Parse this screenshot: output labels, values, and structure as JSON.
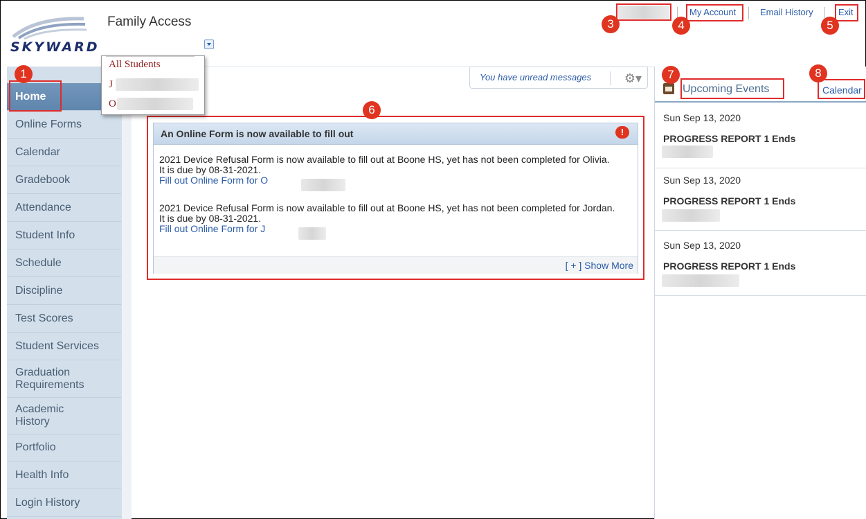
{
  "header": {
    "logo_text": "SKYWARD",
    "app_title": "Family Access"
  },
  "student_dropdown": {
    "items": [
      "All Students",
      "J",
      "O"
    ]
  },
  "topnav": {
    "my_account": "My Account",
    "email_history": "Email History",
    "exit": "Exit"
  },
  "sidebar": {
    "items": [
      {
        "label": "Home",
        "active": true
      },
      {
        "label": "Online Forms"
      },
      {
        "label": "Calendar"
      },
      {
        "label": "Gradebook"
      },
      {
        "label": "Attendance"
      },
      {
        "label": "Student Info"
      },
      {
        "label": "Schedule"
      },
      {
        "label": "Discipline"
      },
      {
        "label": "Test Scores"
      },
      {
        "label": "Student Services"
      },
      {
        "label": "Graduation Requirements"
      },
      {
        "label": "Academic History"
      },
      {
        "label": "Portfolio"
      },
      {
        "label": "Health Info"
      },
      {
        "label": "Login History"
      }
    ]
  },
  "messages": {
    "unread_text": "You have unread messages"
  },
  "form_card": {
    "title": "An Online Form is now available to fill out",
    "alert_icon": "!",
    "notices": [
      {
        "text": "2021 Device Refusal Form is now available to fill out at Boone HS, yet has not been completed for Olivia.  It is due by 08-31-2021.",
        "link": "Fill out Online Form for O"
      },
      {
        "text": "2021 Device Refusal Form is now available to fill out at Boone HS, yet has not been completed for Jordan.  It is due by 08-31-2021.",
        "link": "Fill out Online Form for J"
      }
    ],
    "show_more": "[ + ] Show More"
  },
  "events": {
    "title": "Upcoming Events",
    "calendar_link": "Calendar",
    "items": [
      {
        "date": "Sun Sep 13, 2020",
        "name": "PROGRESS REPORT 1 Ends"
      },
      {
        "date": "Sun Sep 13, 2020",
        "name": "PROGRESS REPORT 1 Ends"
      },
      {
        "date": "Sun Sep 13, 2020",
        "name": "PROGRESS REPORT 1 Ends"
      }
    ]
  },
  "annotations": {
    "badges": [
      "1",
      "3",
      "4",
      "5",
      "6",
      "7",
      "8"
    ]
  },
  "colors": {
    "accent_link": "#2b5ca8",
    "annotation_red": "#e03420",
    "sidebar_bg": "#d3e0ec",
    "active_nav": "#6b8fb5"
  }
}
